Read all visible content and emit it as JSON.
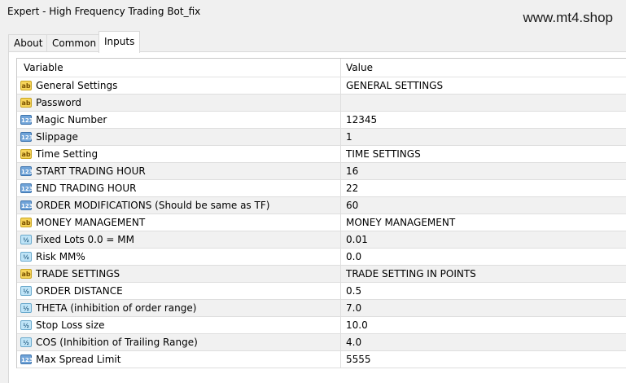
{
  "window": {
    "title": "Expert - High Frequency Trading Bot_fix",
    "watermark": "www.mt4.shop"
  },
  "tabs": [
    {
      "label": "About",
      "active": false
    },
    {
      "label": "Common",
      "active": false
    },
    {
      "label": "Inputs",
      "active": true
    }
  ],
  "table": {
    "columns": {
      "variable": "Variable",
      "value": "Value"
    },
    "rows": [
      {
        "type": "ab",
        "variable": "General Settings",
        "value": "GENERAL SETTINGS"
      },
      {
        "type": "ab",
        "variable": "Password",
        "value": ""
      },
      {
        "type": "123",
        "variable": "Magic Number",
        "value": "12345"
      },
      {
        "type": "123",
        "variable": "Slippage",
        "value": "1"
      },
      {
        "type": "ab",
        "variable": "Time Setting",
        "value": "TIME SETTINGS"
      },
      {
        "type": "123",
        "variable": "START TRADING HOUR",
        "value": "16"
      },
      {
        "type": "123",
        "variable": "END TRADING HOUR",
        "value": "22"
      },
      {
        "type": "123",
        "variable": "ORDER MODIFICATIONS (Should be same as TF)",
        "value": "60"
      },
      {
        "type": "ab",
        "variable": "MONEY MANAGEMENT",
        "value": "MONEY MANAGEMENT"
      },
      {
        "type": "frac",
        "variable": "Fixed Lots 0.0 = MM",
        "value": "0.01"
      },
      {
        "type": "frac",
        "variable": "Risk MM%",
        "value": "0.0"
      },
      {
        "type": "ab",
        "variable": "TRADE SETTINGS",
        "value": "TRADE SETTING IN POINTS"
      },
      {
        "type": "frac",
        "variable": "ORDER DISTANCE",
        "value": "0.5"
      },
      {
        "type": "frac",
        "variable": "THETA (inhibition of order range)",
        "value": "7.0"
      },
      {
        "type": "frac",
        "variable": "Stop Loss size",
        "value": "10.0"
      },
      {
        "type": "frac",
        "variable": "COS (Inhibition of Trailing Range)",
        "value": "4.0"
      },
      {
        "type": "123",
        "variable": "Max Spread Limit",
        "value": "5555"
      }
    ]
  },
  "icon_glyphs": {
    "ab": "ab",
    "123": "123",
    "frac": "½"
  },
  "icon_names": {
    "ab": "string-type-icon",
    "123": "integer-type-icon",
    "frac": "double-type-icon"
  }
}
